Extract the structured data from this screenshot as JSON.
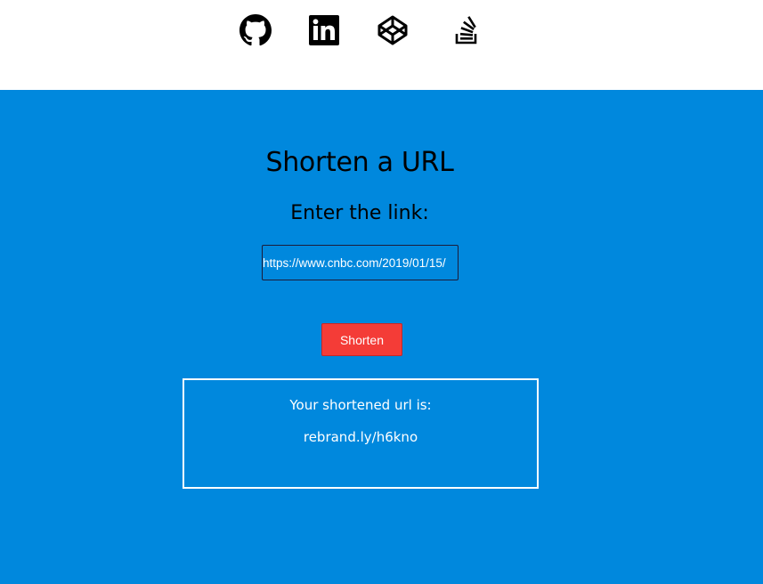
{
  "social_links": [
    {
      "name": "github",
      "icon": "github-icon"
    },
    {
      "name": "linkedin",
      "icon": "linkedin-icon"
    },
    {
      "name": "codepen",
      "icon": "codepen-icon"
    },
    {
      "name": "stackoverflow",
      "icon": "stackoverflow-icon"
    }
  ],
  "main": {
    "title": "Shorten a URL",
    "subtitle": "Enter the link:",
    "url_input_value": "https://www.cnbc.com/2019/01/15/",
    "shorten_label": "Shorten",
    "result_label": "Your shortened url is:",
    "result_value": "rebrand.ly/h6kno"
  },
  "colors": {
    "background_main": "#0088dd",
    "button": "#f43c37",
    "header_background": "#ffffff"
  }
}
